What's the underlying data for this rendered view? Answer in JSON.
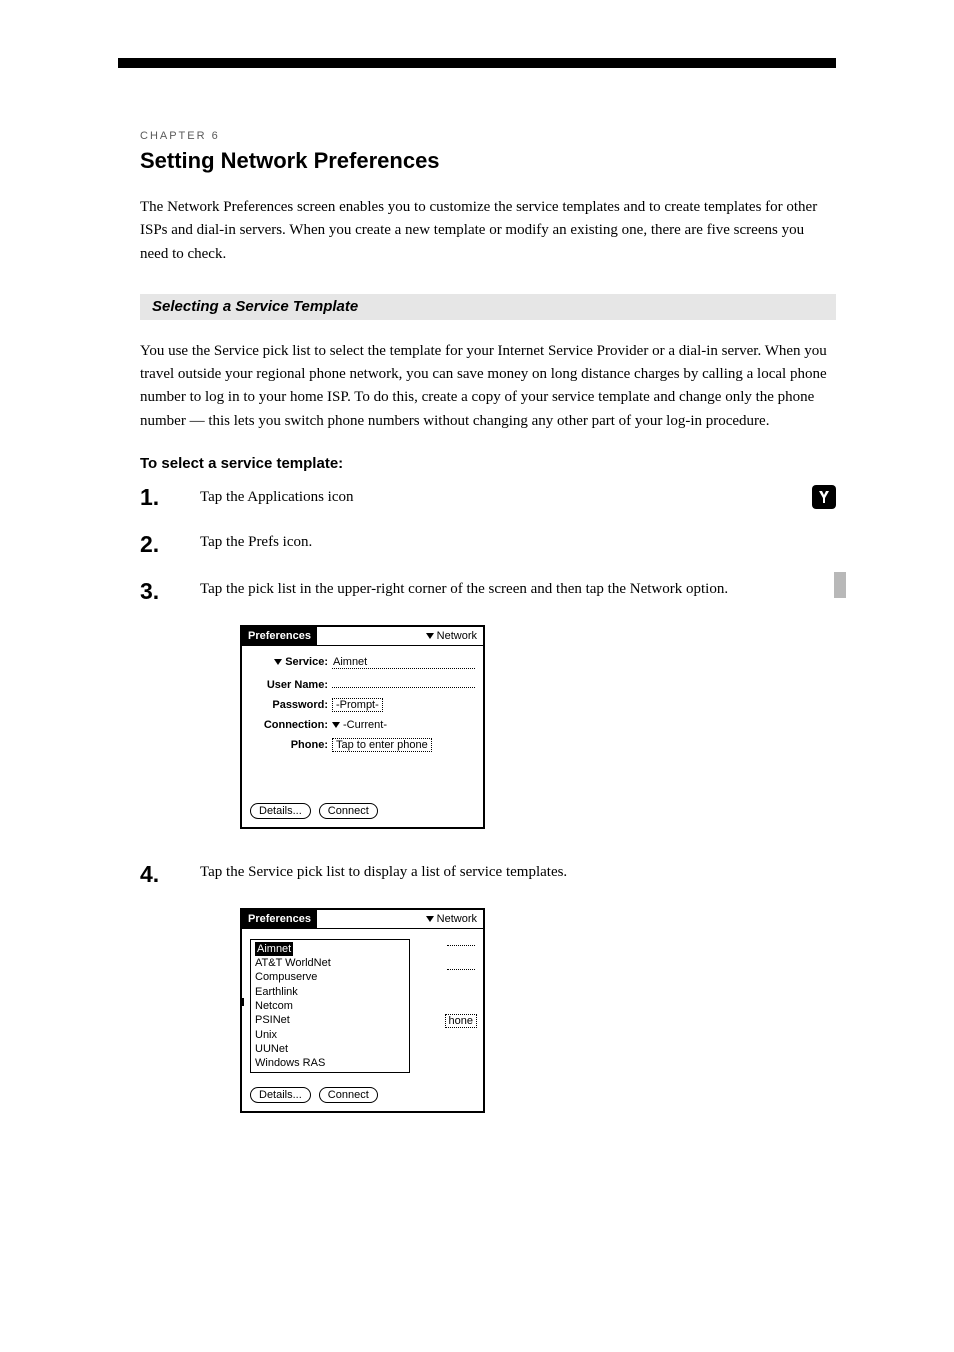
{
  "section_label": "CHAPTER 6",
  "heading": "Setting Network Preferences",
  "intro": "The Network Preferences screen enables you to customize the service templates and to create templates for other ISPs and dial-in servers. When you create a new template or modify an existing one, there are five screens you need to check.",
  "band_title": "Selecting a Service Template",
  "band_text": "You use the Service pick list to select the template for your Internet Service Provider or a dial-in server. When you travel outside your regional phone network, you can save money on long distance charges by calling a local phone number to log in to your home ISP. To do this, create a copy of your service template and change only the phone number — this lets you switch phone numbers without changing any other part of your log-in procedure.",
  "steps_label": "To select a service template:",
  "steps": {
    "s1": {
      "num": "1.",
      "text": "Tap the Applications icon"
    },
    "s2": {
      "num": "2.",
      "text": "Tap the Prefs icon."
    },
    "s3": {
      "num": "3.",
      "text": "Tap the pick list in the upper-right corner of the screen and then tap the Network option."
    },
    "s4": {
      "num": "4.",
      "text": "Tap the Service pick list to display a list of service templates."
    }
  },
  "screen": {
    "title": "Preferences",
    "picker": "Network",
    "labels": {
      "service": "Service:",
      "user": "User Name:",
      "password": "Password:",
      "connection": "Connection:",
      "phone": "Phone:"
    },
    "values": {
      "service": "Aimnet",
      "password": "-Prompt-",
      "connection": "-Current-",
      "phone": "Tap to enter phone",
      "phone_frag": "hone"
    },
    "buttons": {
      "details": "Details...",
      "connect": "Connect"
    }
  },
  "popup_items": [
    "Aimnet",
    "AT&T WorldNet",
    "Compuserve",
    "Earthlink",
    "Netcom",
    "PSINet",
    "Unix",
    "UUNet",
    "Windows RAS"
  ]
}
